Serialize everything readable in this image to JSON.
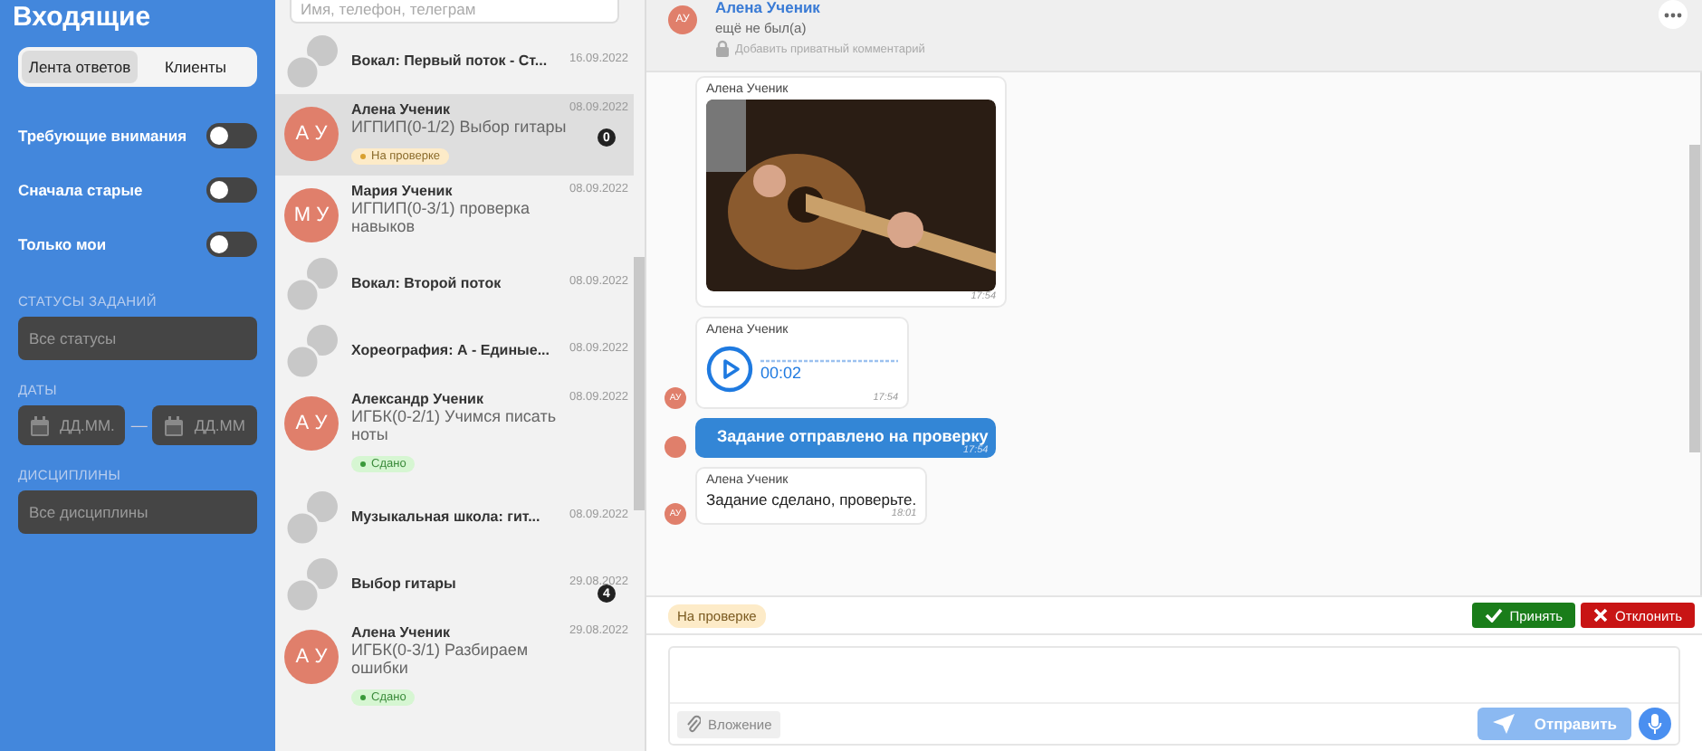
{
  "sidebar": {
    "title": "Входящие",
    "segments": [
      {
        "label": "Лента ответов",
        "selected": true
      },
      {
        "label": "Клиенты",
        "selected": false
      }
    ],
    "toggles": [
      {
        "label": "Требующие внимания",
        "on": false
      },
      {
        "label": "Сначала старые",
        "on": false
      },
      {
        "label": "Только мои",
        "on": false
      }
    ],
    "filters": [
      {
        "kind": "select",
        "label": "СТАТУСЫ ЗАДАНИЙ",
        "placeholder": "Все статусы"
      },
      {
        "kind": "daterange",
        "label": "ДАТЫ",
        "from_placeholder": "ДД.ММ.",
        "separator": "—",
        "to_placeholder": "ДД.ММ"
      },
      {
        "kind": "select",
        "label": "ДИСЦИПЛИНЫ",
        "placeholder": "Все дисциплины"
      }
    ]
  },
  "conversations": {
    "search": {
      "placeholder": "Имя, телефон, телеграм"
    },
    "items": [
      {
        "kind": "group",
        "title": "Вокал: Первый поток - Ст...",
        "date": "16.09.2022",
        "selected": false
      },
      {
        "kind": "person",
        "initials": "А У",
        "title": "Алена Ученик",
        "subtitle": "ИГПИП(0-1/2) Выбор гитары",
        "date": "08.09.2022",
        "unread": "0",
        "status": {
          "kind": "review",
          "label": "На проверке"
        },
        "selected": true
      },
      {
        "kind": "person",
        "initials": "М У",
        "title": "Мария Ученик",
        "subtitle": "ИГПИП(0-3/1) проверка навыков",
        "date": "08.09.2022",
        "selected": false
      },
      {
        "kind": "group",
        "title": "Вокал: Второй поток",
        "date": "08.09.2022",
        "selected": false
      },
      {
        "kind": "group",
        "title": "Хореография: А - Единые...",
        "date": "08.09.2022",
        "selected": false
      },
      {
        "kind": "person",
        "initials": "А У",
        "title": "Александр Ученик",
        "subtitle": "ИГБК(0-2/1) Учимся писать ноты",
        "date": "08.09.2022",
        "status": {
          "kind": "done",
          "label": "Сдано"
        },
        "selected": false
      },
      {
        "kind": "group",
        "title": "Музыкальная школа: гит...",
        "date": "08.09.2022",
        "selected": false
      },
      {
        "kind": "group",
        "title": "Выбор гитары",
        "date": "29.08.2022",
        "unread": "4",
        "selected": false
      },
      {
        "kind": "person",
        "initials": "А У",
        "title": "Алена Ученик",
        "subtitle": "ИГБК(0-3/1) Разбираем ошибки",
        "date": "29.08.2022",
        "status": {
          "kind": "done",
          "label": "Сдано"
        },
        "selected": false
      }
    ]
  },
  "chat": {
    "header": {
      "initials": "АУ",
      "name": "Алена Ученик",
      "presence": "ещё не был(а)",
      "private_comment": "Добавить приватный комментарий"
    },
    "messages": [
      {
        "kind": "photo",
        "sender": "Алена Ученик",
        "time": "17:54"
      },
      {
        "kind": "audio",
        "avatar": "АУ",
        "sender": "Алена Ученик",
        "duration": "00:02",
        "time": "17:54"
      },
      {
        "kind": "system",
        "text": "Задание отправлено на проверку",
        "time": "17:54"
      },
      {
        "kind": "text",
        "avatar": "АУ",
        "sender": "Алена Ученик",
        "text": "Задание сделано, проверьте.",
        "time": "18:01"
      }
    ],
    "status_bar": {
      "status": "На проверке",
      "accept": "Принять",
      "reject": "Отклонить"
    },
    "composer": {
      "attach": "Вложение",
      "send": "Отправить"
    }
  }
}
